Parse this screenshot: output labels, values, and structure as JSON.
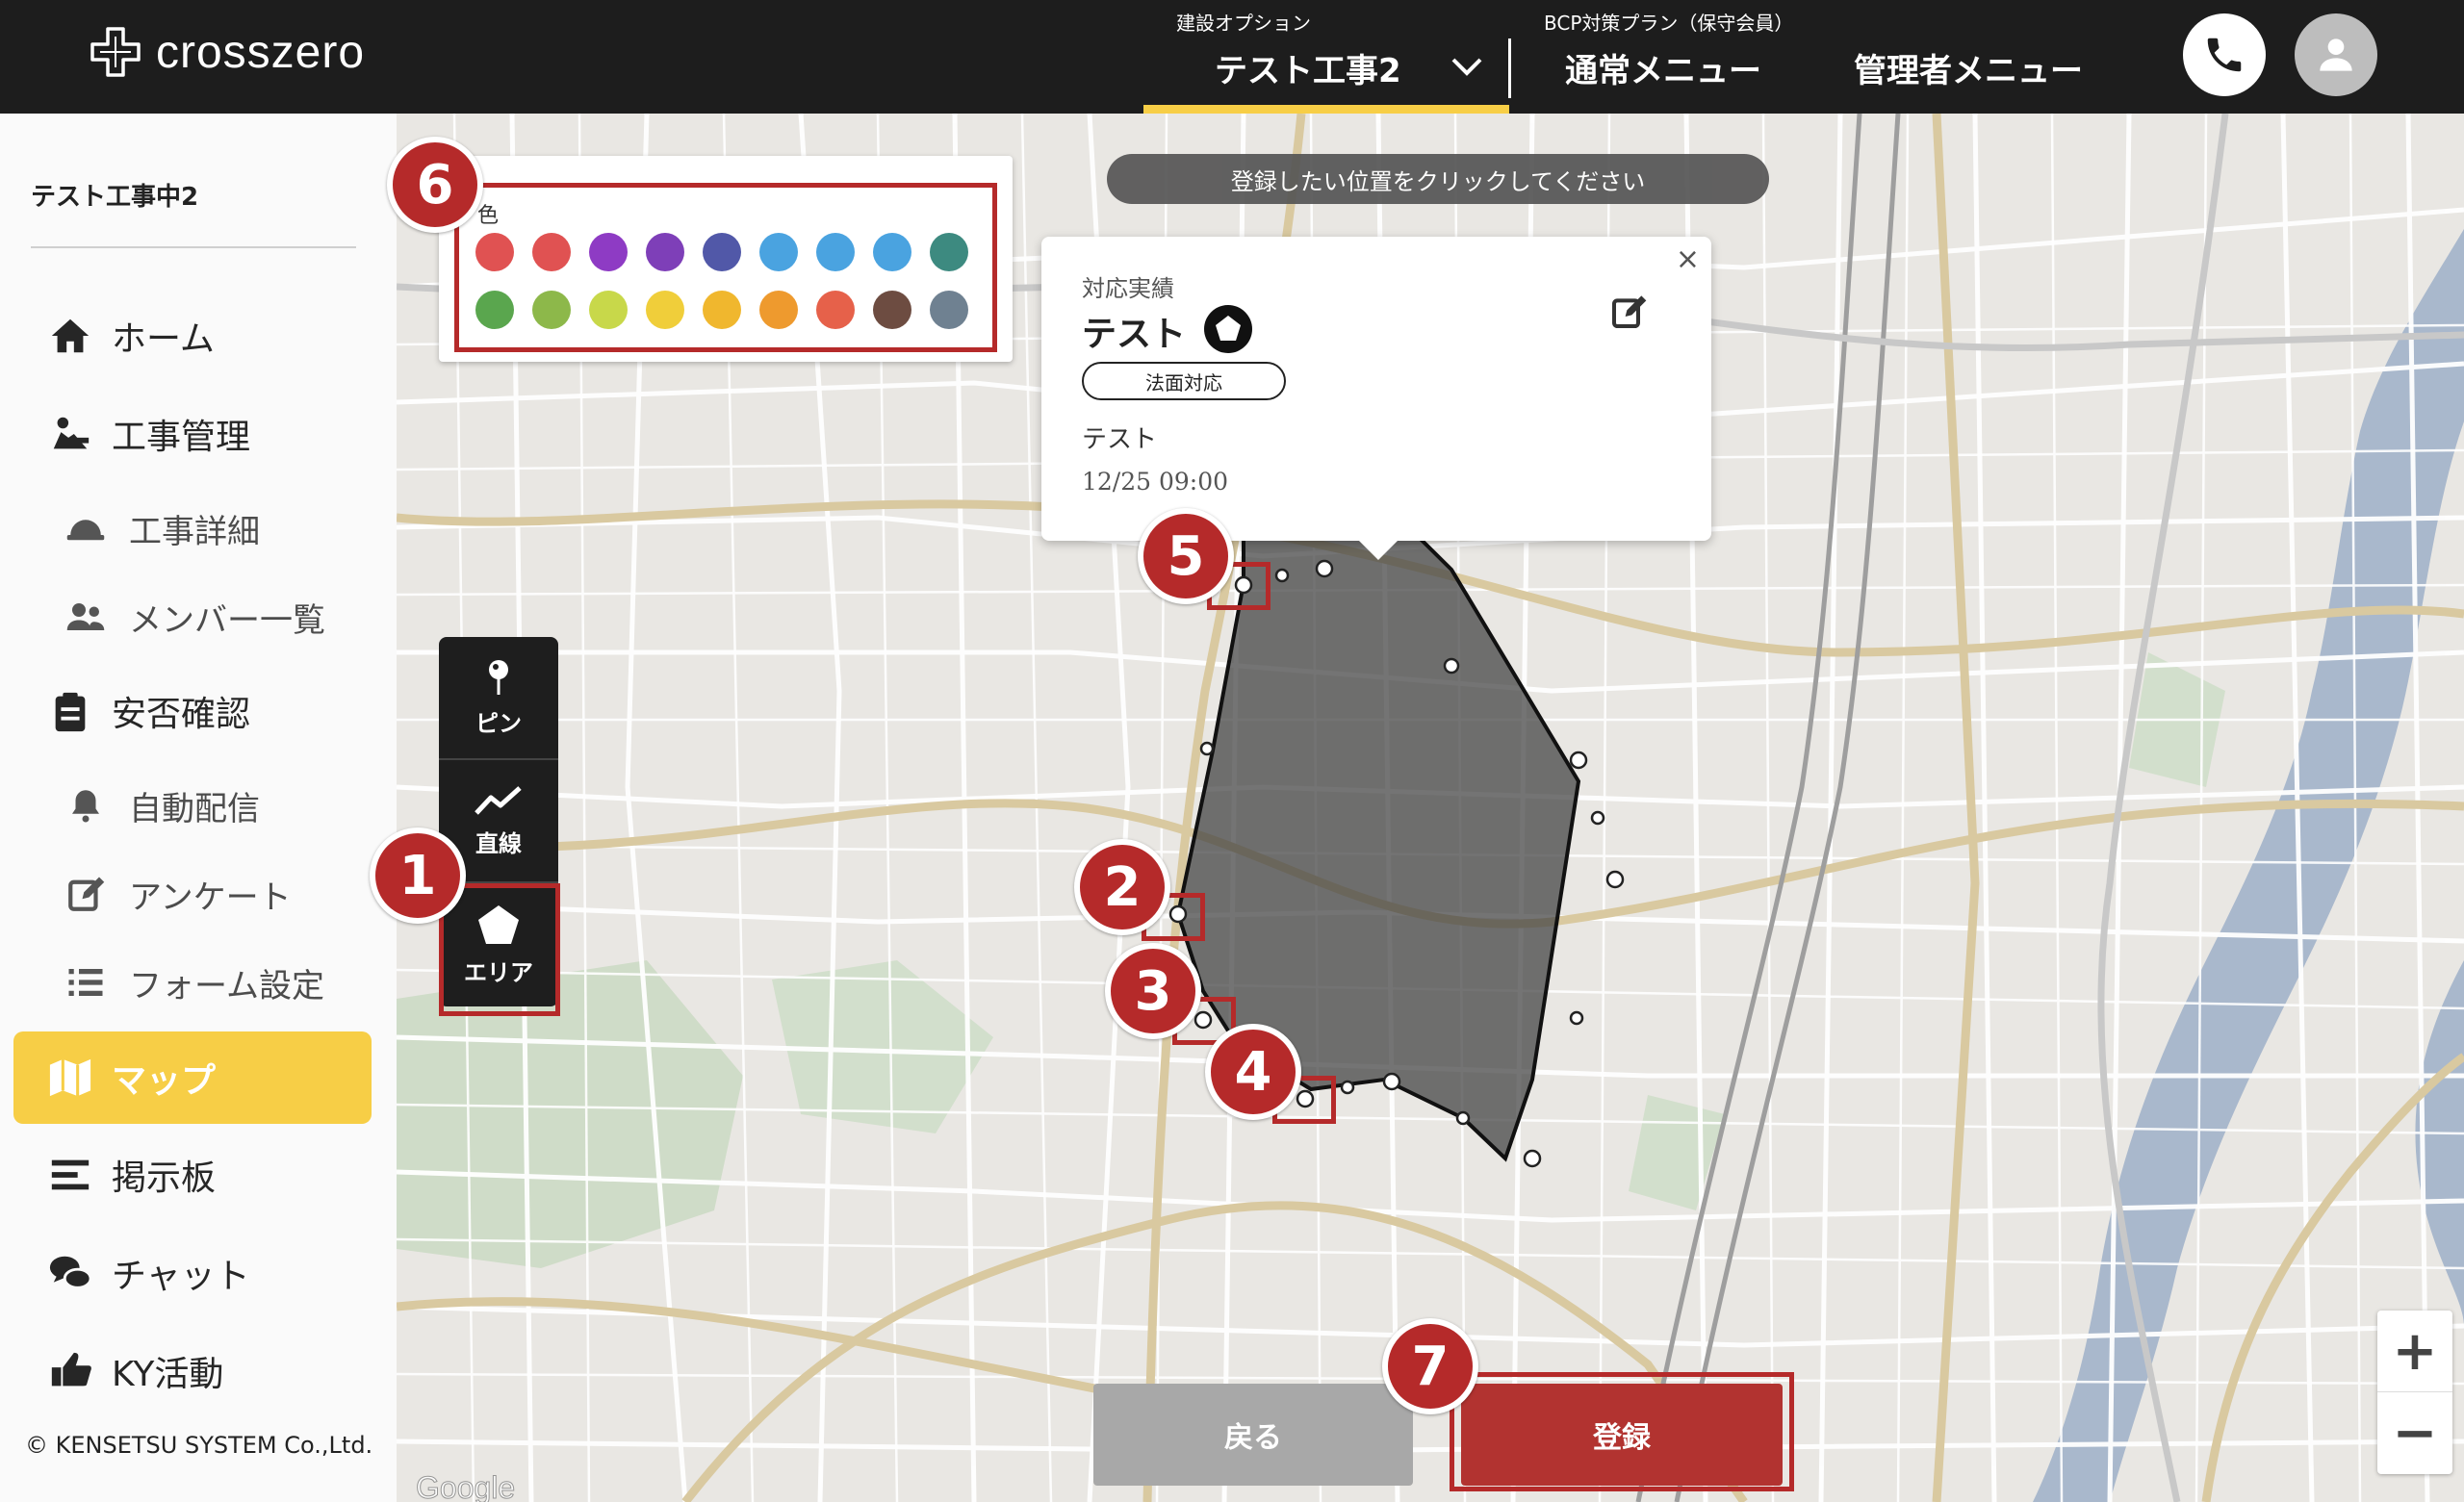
{
  "header": {
    "logo_text": "crosszero",
    "project_caption": "建設オプション",
    "project_name": "テスト工事2",
    "plan_caption": "BCP対策プラン（保守会員）",
    "normal_menu": "通常メニュー",
    "admin_menu": "管理者メニュー"
  },
  "sidebar": {
    "project_name": "テスト工事中2",
    "items": [
      {
        "label": "ホーム",
        "icon": "home-icon"
      },
      {
        "label": "工事管理",
        "icon": "construction-icon"
      },
      {
        "label": "工事詳細",
        "icon": "helmet-icon"
      },
      {
        "label": "メンバー一覧",
        "icon": "members-icon"
      },
      {
        "label": "安否確認",
        "icon": "clipboard-icon"
      },
      {
        "label": "自動配信",
        "icon": "bell-icon"
      },
      {
        "label": "アンケート",
        "icon": "edit-icon"
      },
      {
        "label": "フォーム設定",
        "icon": "list-icon"
      },
      {
        "label": "マップ",
        "icon": "map-icon"
      },
      {
        "label": "掲示板",
        "icon": "board-icon"
      },
      {
        "label": "チャット",
        "icon": "chat-icon"
      },
      {
        "label": "KY活動",
        "icon": "thumb-icon"
      }
    ],
    "copyright": "© KENSETSU SYSTEM Co.,Ltd."
  },
  "map": {
    "hint": "登録したい位置をクリックしてください",
    "tools": {
      "pin": "ピン",
      "line": "直線",
      "area": "エリア"
    },
    "palette": {
      "label": "色",
      "colors": [
        "#e05252",
        "#e05252",
        "#8e3bc4",
        "#7e3fb8",
        "#5158a8",
        "#4aa3e0",
        "#4aa3e0",
        "#4aa3e0",
        "#3d8a80",
        "#5aa64e",
        "#8db84a",
        "#c8d84a",
        "#f0ce3a",
        "#f0b72e",
        "#ee9a2e",
        "#e6614a",
        "#6d4c41",
        "#6f8191"
      ]
    },
    "popup": {
      "category": "対応実績",
      "title": "テスト",
      "tag": "法面対応",
      "description": "テスト",
      "datetime": "12/25 09:00"
    },
    "buttons": {
      "back": "戻る",
      "register": "登録"
    },
    "zoom": {
      "in": "+",
      "out": "−"
    },
    "attribution": "Google",
    "markers": [
      "1",
      "2",
      "3",
      "4",
      "5",
      "6",
      "7"
    ]
  }
}
